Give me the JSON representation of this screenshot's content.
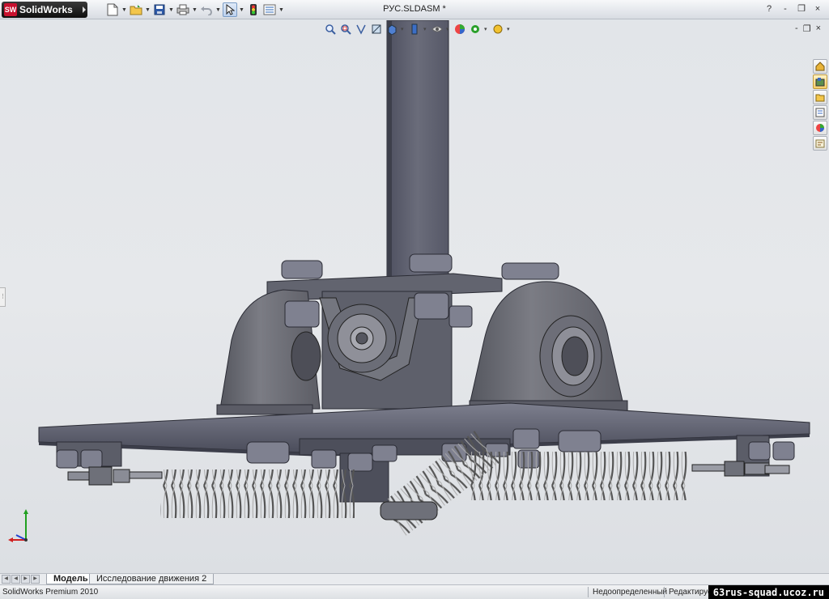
{
  "app": {
    "name": "SolidWorks",
    "logo_mark": "SW",
    "document_title": "РУС.SLDASM *"
  },
  "toolbar": {
    "icons": [
      "new-icon",
      "open-icon",
      "save-icon",
      "print-icon",
      "undo-icon",
      "select-icon",
      "rebuild-icon",
      "options-icon"
    ]
  },
  "window_controls": [
    "?",
    "-",
    "❐",
    "×"
  ],
  "viewport_controls": [
    "-",
    "❐",
    "×"
  ],
  "heads_up_toolbar": [
    "zoom-to-fit-icon",
    "zoom-to-area-icon",
    "previous-view-icon",
    "section-view-icon",
    "view-orientation-icon",
    "display-style-icon",
    "hide-show-items-icon",
    "edit-appearance-icon",
    "apply-scene-icon"
  ],
  "task_pane": [
    "solidworks-resources-icon",
    "design-library-icon",
    "file-explorer-icon",
    "view-palette-icon",
    "appearances-icon",
    "custom-properties-icon"
  ],
  "tabs": {
    "model": "Модель",
    "motion_study": "Исследование движения 2"
  },
  "status": {
    "product": "SolidWorks Premium 2010",
    "definition": "Недоопределенный",
    "editing": "Редактирует",
    "watermark": "63rus-squad.ucoz.ru"
  },
  "colors": {
    "model_metal": "#5d5f6e",
    "model_dark": "#3c3e4a",
    "model_light": "#8a8c9a",
    "viewport_bg": "#e4e6e9",
    "triad_x": "#d02020",
    "triad_y": "#20a020",
    "triad_z": "#2040d0"
  }
}
